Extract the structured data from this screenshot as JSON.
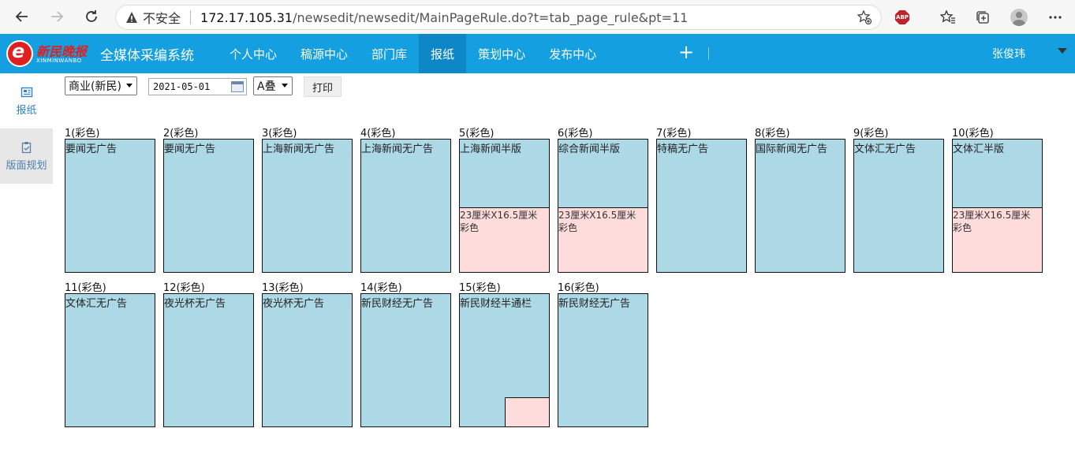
{
  "browser": {
    "insecure_label": "不安全",
    "url_host": "172.17.105.31",
    "url_path": "/newsedit/newsedit/MainPageRule.do?t=tab_page_rule&pt=11",
    "abp_label": "ABP"
  },
  "header": {
    "logo_cn": "新民晚报",
    "logo_en": "XINMINWANBO",
    "logo_letter": "e",
    "system_title": "全媒体采编系统",
    "nav": [
      {
        "label": "个人中心",
        "active": false
      },
      {
        "label": "稿源中心",
        "active": false
      },
      {
        "label": "部门库",
        "active": false
      },
      {
        "label": "报纸",
        "active": true
      },
      {
        "label": "策划中心",
        "active": false
      },
      {
        "label": "发布中心",
        "active": false
      }
    ],
    "plus_label": "+",
    "user_name": "张俊玮"
  },
  "sidebar": {
    "items": [
      {
        "label": "报纸",
        "icon": "newspaper-icon"
      },
      {
        "label": "版面规划",
        "icon": "layout-plan-icon"
      }
    ]
  },
  "toolbar": {
    "edition_value": "商业(新民)",
    "date_value": "2021-05-01",
    "stack_value": "A叠",
    "print_label": "打印"
  },
  "pages": [
    {
      "label": "1(彩色)",
      "name": "要闻无广告",
      "ad": null
    },
    {
      "label": "2(彩色)",
      "name": "要闻无广告",
      "ad": null
    },
    {
      "label": "3(彩色)",
      "name": "上海新闻无广告",
      "ad": null
    },
    {
      "label": "4(彩色)",
      "name": "上海新闻无广告",
      "ad": null
    },
    {
      "label": "5(彩色)",
      "name": "上海新闻半版",
      "ad": "23厘米X16.5厘米彩色"
    },
    {
      "label": "6(彩色)",
      "name": "综合新闻半版",
      "ad": "23厘米X16.5厘米彩色"
    },
    {
      "label": "7(彩色)",
      "name": "特稿无广告",
      "ad": null
    },
    {
      "label": "8(彩色)",
      "name": "国际新闻无广告",
      "ad": null
    },
    {
      "label": "9(彩色)",
      "name": "文体汇无广告",
      "ad": null
    },
    {
      "label": "10(彩色)",
      "name": "文体汇半版",
      "ad": "23厘米X16.5厘米彩色"
    },
    {
      "label": "11(彩色)",
      "name": "文体汇无广告",
      "ad": null
    },
    {
      "label": "12(彩色)",
      "name": "夜光杯无广告",
      "ad": null
    },
    {
      "label": "13(彩色)",
      "name": "夜光杯无广告",
      "ad": null
    },
    {
      "label": "14(彩色)",
      "name": "新民财经无广告",
      "ad": null
    },
    {
      "label": "15(彩色)",
      "name": "新民财经半通栏",
      "ad": ""
    },
    {
      "label": "16(彩色)",
      "name": "新民财经无广告",
      "ad": null
    }
  ],
  "colors": {
    "header_bg": "#139fe0",
    "nav_active_bg": "#0d87c6",
    "page_bg": "#add8e6",
    "ad_bg": "#ffdcdc"
  }
}
